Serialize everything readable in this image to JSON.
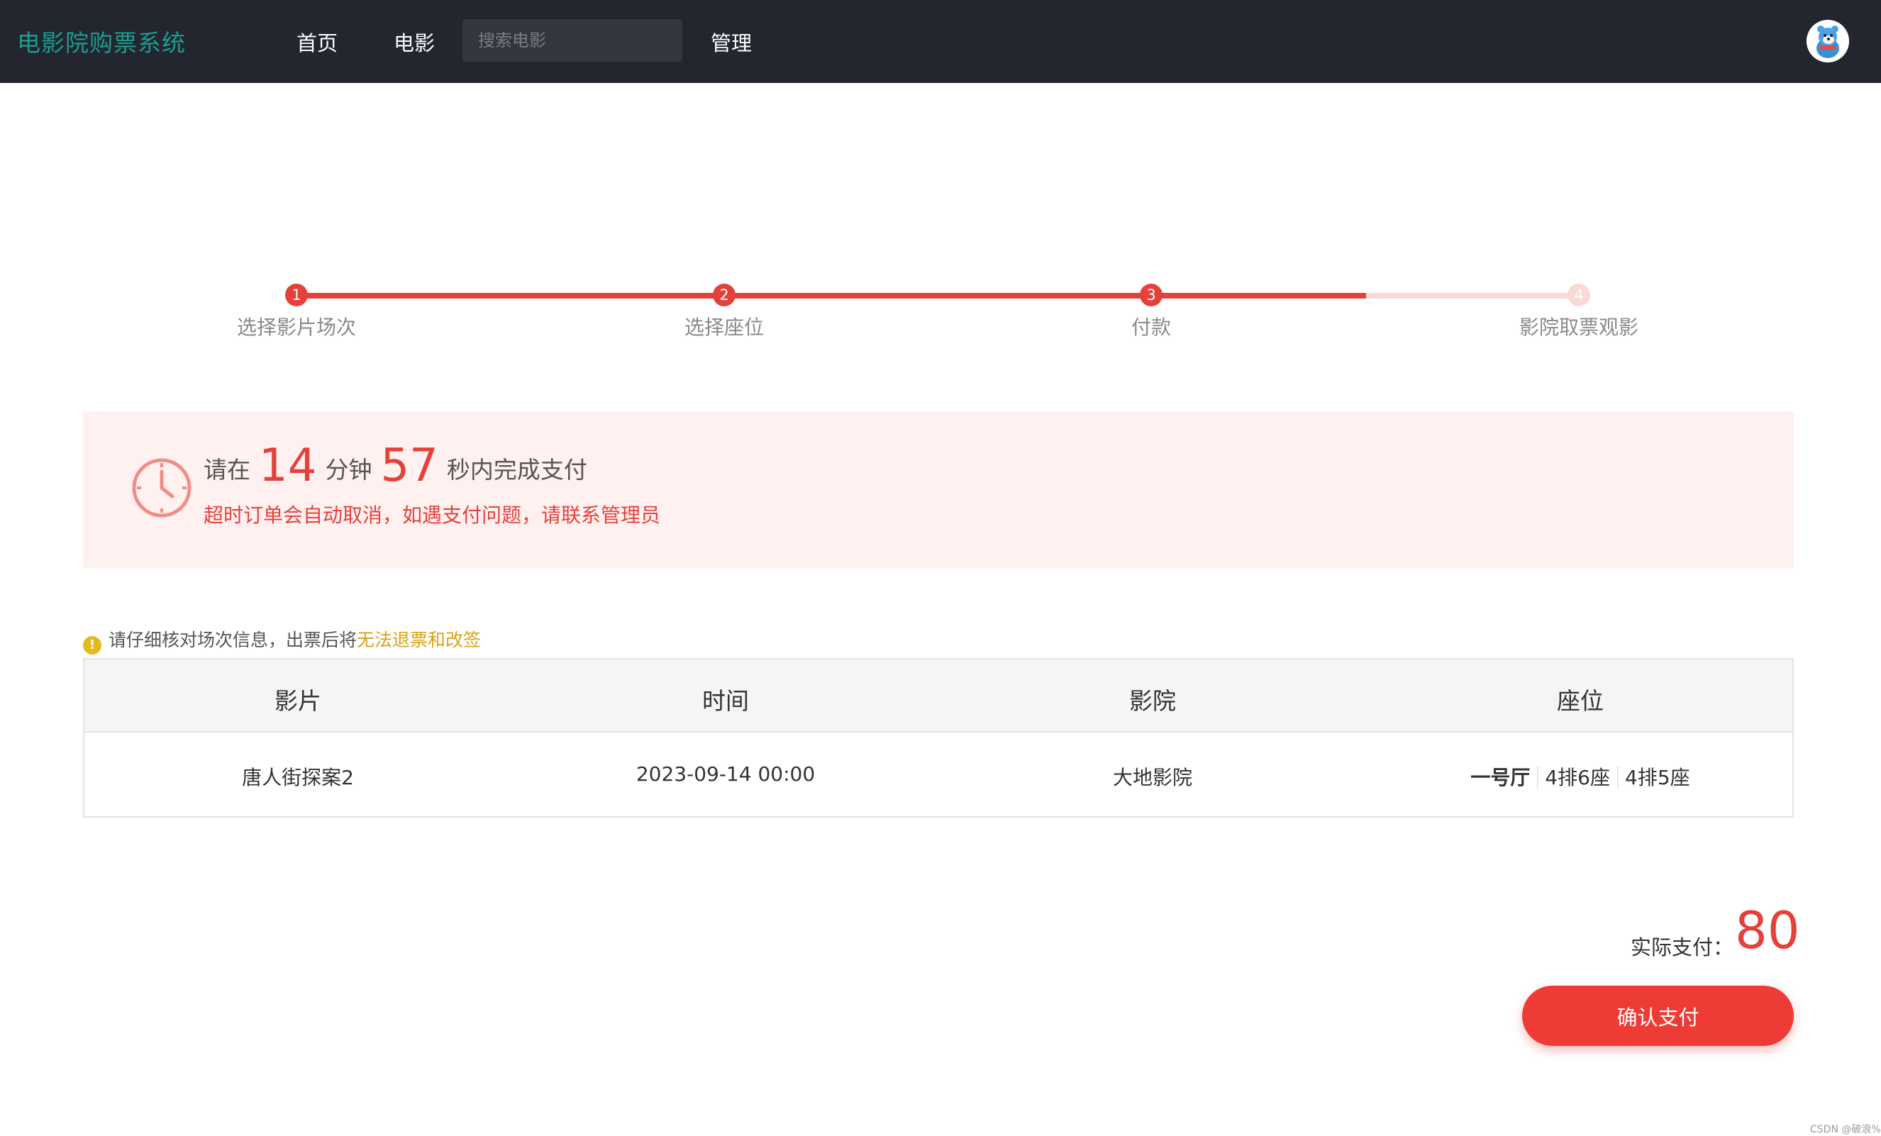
{
  "header": {
    "brand": "电影院购票系统",
    "nav": [
      "首页",
      "电影",
      "管理"
    ],
    "search_placeholder": "搜索电影",
    "avatar_icon": "avatar-icon"
  },
  "steps": {
    "items": [
      {
        "num": "1",
        "label": "选择影片场次"
      },
      {
        "num": "2",
        "label": "选择座位"
      },
      {
        "num": "3",
        "label": "付款"
      },
      {
        "num": "4",
        "label": "影院取票观影"
      }
    ],
    "current_step": 3,
    "accent_color": "#e5413b"
  },
  "countdown": {
    "prefix": "请在",
    "minutes": "14",
    "min_unit": "分钟",
    "seconds": "57",
    "suffix": "秒内完成支付",
    "warning": "超时订单会自动取消，如遇支付问题，请联系管理员",
    "icon": "clock-icon"
  },
  "notice": {
    "icon": "info-icon",
    "text": "请仔细核对场次信息，出票后将",
    "highlight": "无法退票和改签"
  },
  "order_table": {
    "headers": [
      "影片",
      "时间",
      "影院",
      "座位"
    ],
    "row": {
      "movie": "唐人街探案2",
      "time": "2023-09-14 00:00",
      "cinema": "大地影院",
      "hall": "一号厅",
      "seats": [
        "4排6座",
        "4排5座"
      ]
    }
  },
  "payment": {
    "label": "实际支付：",
    "amount": "80",
    "confirm_button": "确认支付"
  },
  "watermark": "CSDN @破浪%"
}
